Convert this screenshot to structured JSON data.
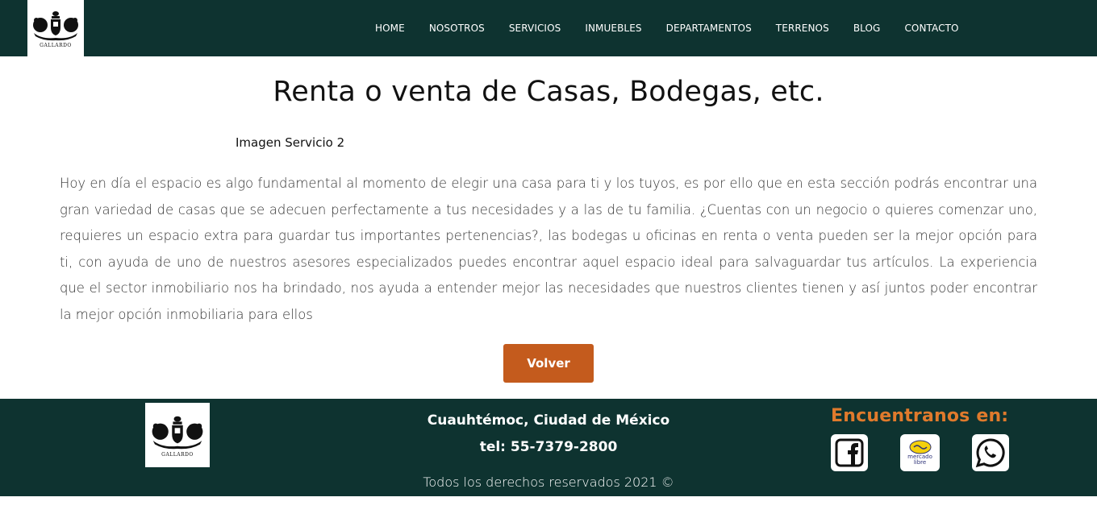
{
  "header": {
    "logo_text": "GALLARDO",
    "nav": [
      {
        "label": "HOME"
      },
      {
        "label": "NOSOTROS"
      },
      {
        "label": "SERVICIOS"
      },
      {
        "label": "INMUEBLES"
      },
      {
        "label": "DEPARTAMENTOS"
      },
      {
        "label": "TERRENOS"
      },
      {
        "label": "BLOG"
      },
      {
        "label": "CONTACTO"
      }
    ]
  },
  "main": {
    "title": "Renta o venta de Casas, Bodegas, etc.",
    "image_alt": "Imagen Servicio 2",
    "description": "Hoy en día el espacio es algo fundamental al momento de elegir una casa para ti y los tuyos, es por ello que en esta sección podrás encontrar una gran variedad de casas que se adecuen perfectamente a tus necesidades y a las de tu familia. ¿Cuentas con un negocio o quieres comenzar uno, requieres un espacio extra para guardar tus importantes pertenencias?, las bodegas u oficinas en renta o venta pueden ser la mejor opción para ti, con ayuda de uno de nuestros asesores especializados puedes encontrar aquel espacio ideal para salvaguardar tus artículos. La experiencia que el sector inmobiliario nos ha brindado, nos ayuda a entender mejor las necesidades que nuestros clientes tienen y así juntos poder encontrar la mejor opción inmobiliaria para ellos",
    "back_label": "Volver"
  },
  "footer": {
    "logo_text": "GALLARDO",
    "address": "Cuauhtémoc, Ciudad de México",
    "phone": "tel: 55-7379-2800",
    "rights": "Todos los derechos reservados 2021 ©",
    "find_us": "Encuentranos en:",
    "mercadolibre_line1": "mercado",
    "mercadolibre_line2": "libre",
    "social_icons": [
      "facebook-icon",
      "mercadolibre-icon",
      "whatsapp-icon"
    ]
  },
  "colors": {
    "header_bg": "#0e3330",
    "footer_bg": "#0e3330",
    "accent": "#c45b1d",
    "find_us": "#e07a2c"
  }
}
